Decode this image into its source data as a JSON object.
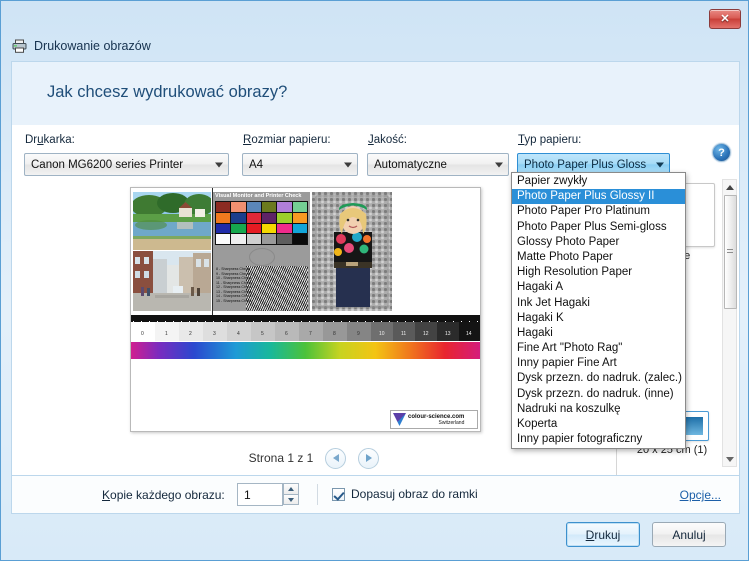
{
  "window": {
    "title": "Drukowanie obrazów",
    "close_label": "✕",
    "icon": "printer-icon"
  },
  "header": {
    "question": "Jak chcesz wydrukować obrazy?"
  },
  "selectors": [
    {
      "label": "Drukarka:",
      "accel_before": "Dr",
      "accel": "u",
      "accel_after": "karka:",
      "value": "Canon MG6200 series Printer",
      "focused": false
    },
    {
      "label": "Rozmiar papieru:",
      "accel_before": "R",
      "accel": "o",
      "accel_after": "zmiar papieru:",
      "value": "A4",
      "focused": false
    },
    {
      "label": "Jakość:",
      "accel_before": "",
      "accel": "J",
      "accel_after": "akość:",
      "value": "Automatyczne",
      "focused": false
    },
    {
      "label": "Typ papieru:",
      "accel_before": "",
      "accel": "T",
      "accel_after": "yp papieru:",
      "value": "Photo Paper Plus Gloss",
      "focused": true
    }
  ],
  "help_icon_label": "?",
  "paper_type_dropdown": {
    "selected_index": 1,
    "items": [
      "Papier zwykły",
      "Photo Paper Plus Glossy II",
      "Photo Paper Pro Platinum",
      "Photo Paper Plus Semi-gloss",
      "Glossy Photo Paper",
      "Matte Photo Paper",
      "High Resolution Paper",
      "Hagaki A",
      "Ink Jet Hagaki",
      "Hagaki K",
      "Hagaki",
      "Fine Art \"Photo Rag\"",
      "Inny papier Fine Art",
      "Dysk przezn. do nadruk. (zalec.)",
      "Dysk przezn. do nadruk. (inne)",
      "Nadruki na koszulkę",
      "Koperta",
      "Inny papier fotograficzny"
    ]
  },
  "preview": {
    "chart_title": "Visual Monitor and Printer Check",
    "brand_name": "colour-science.com",
    "brand_country": "Switzerland",
    "sharpness_lines": [
      "8 - Sharpness Check",
      "9 - Sharpness Check",
      "10 - Sharpness Check",
      "11 - Sharpness Check",
      "12 - Sharpness Check",
      "13 - Sharpness Check",
      "14 - Sharpness Check",
      "15 - Sharpness Check"
    ]
  },
  "page_nav": {
    "status": "Strona 1 z 1",
    "prev_icon": "chevron-left-icon",
    "next_icon": "chevron-right-icon"
  },
  "layout_sidebar": {
    "partial_item_label": "ronie",
    "items": [
      {
        "caption": "ronie",
        "selected": false
      },
      {
        "caption": "20 x 25 cm (1)",
        "selected": true
      }
    ]
  },
  "options": {
    "copies_label_before": "K",
    "copies_label_accel": "o",
    "copies_label_after": "pie każdego obrazu:",
    "copies_label": "Kopie każdego obrazu:",
    "copies_value": "1",
    "fit_checkbox_label": "Dopasuj obraz do ramki",
    "fit_checkbox_checked": true,
    "options_link": "Opcje..."
  },
  "buttons": {
    "print_before": "D",
    "print_accel": "r",
    "print_after": "ukuj",
    "print": "Drukuj",
    "cancel": "Anuluj"
  },
  "colors": {
    "accent": "#2a8fd8",
    "title_text": "#16324f",
    "header_text": "#1f4e79",
    "link": "#1c5fa8",
    "close_button": "#c93f38"
  }
}
